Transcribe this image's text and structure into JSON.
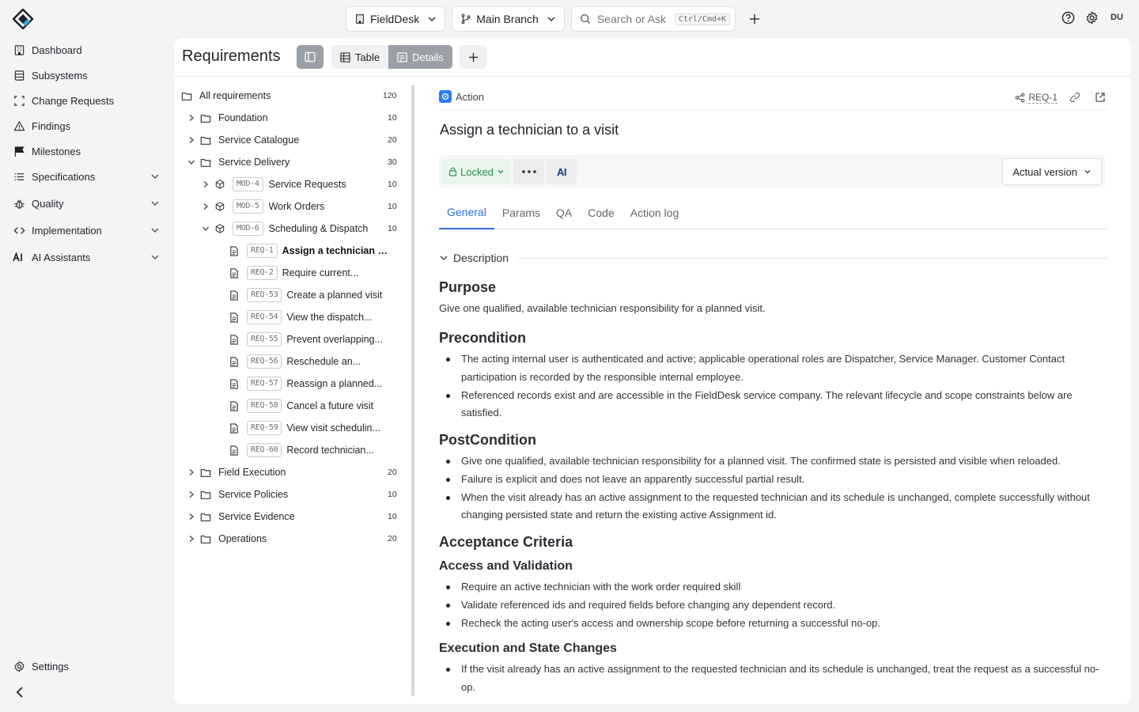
{
  "topbar": {
    "project": "FieldDesk",
    "branch": "Main Branch",
    "search_placeholder": "Search or Ask",
    "search_shortcut": "Ctrl/Cmd+K",
    "avatar": "DU"
  },
  "sidebar": {
    "items": [
      {
        "label": "Dashboard",
        "icon": "building-icon"
      },
      {
        "label": "Subsystems",
        "icon": "database-icon"
      },
      {
        "label": "Change Requests",
        "icon": "frame-icon"
      },
      {
        "label": "Findings",
        "icon": "warning-icon"
      },
      {
        "label": "Milestones",
        "icon": "flag-icon"
      },
      {
        "label": "Specifications",
        "icon": "list-icon"
      },
      {
        "label": "Quality",
        "icon": "bug-icon"
      },
      {
        "label": "Implementation",
        "icon": "code-icon"
      },
      {
        "label": "AI Assistants",
        "icon": "ai-icon"
      }
    ],
    "settings": "Settings"
  },
  "main": {
    "title": "Requirements",
    "views": [
      "Table",
      "Details"
    ],
    "active_view": "Details"
  },
  "tree": {
    "root": {
      "label": "All requirements",
      "count": "120"
    },
    "folders_top": [
      {
        "label": "Foundation",
        "count": "10"
      },
      {
        "label": "Service Catalogue",
        "count": "20"
      },
      {
        "label": "Service Delivery",
        "count": "30"
      }
    ],
    "modules": [
      {
        "tag": "MOD-4",
        "label": "Service Requests",
        "count": "10"
      },
      {
        "tag": "MOD-5",
        "label": "Work Orders",
        "count": "10"
      },
      {
        "tag": "MOD-6",
        "label": "Scheduling & Dispatch",
        "count": "10"
      }
    ],
    "requirements": [
      {
        "tag": "REQ-1",
        "label": "Assign a technician t..."
      },
      {
        "tag": "REQ-2",
        "label": "Require current..."
      },
      {
        "tag": "REQ-53",
        "label": "Create a planned visit"
      },
      {
        "tag": "REQ-54",
        "label": "View the dispatch..."
      },
      {
        "tag": "REQ-55",
        "label": "Prevent overlapping..."
      },
      {
        "tag": "REQ-56",
        "label": "Reschedule an..."
      },
      {
        "tag": "REQ-57",
        "label": "Reassign a planned..."
      },
      {
        "tag": "REQ-58",
        "label": "Cancel a future visit"
      },
      {
        "tag": "REQ-59",
        "label": "View visit schedulin..."
      },
      {
        "tag": "REQ-60",
        "label": "Record technician..."
      }
    ],
    "folders_bottom": [
      {
        "label": "Field Execution",
        "count": "20"
      },
      {
        "label": "Service Policies",
        "count": "10"
      },
      {
        "label": "Service Evidence",
        "count": "10"
      },
      {
        "label": "Operations",
        "count": "20"
      }
    ]
  },
  "detail": {
    "type": "Action",
    "req_id": "REQ-1",
    "title": "Assign a technician to a visit",
    "status": "Locked",
    "ai_label": "AI",
    "version": "Actual version",
    "tabs": [
      "General",
      "Params",
      "QA",
      "Code",
      "Action log"
    ],
    "active_tab": "General",
    "section": "Description",
    "purpose_heading": "Purpose",
    "purpose_text": "Give one qualified, available technician responsibility for a planned visit.",
    "precondition_heading": "Precondition",
    "precondition_items": [
      "The acting internal user is authenticated and active; applicable operational roles are Dispatcher, Service Manager. Customer Contact participation is recorded by the responsible internal employee.",
      "Referenced records exist and are accessible in the FieldDesk service company. The relevant lifecycle and scope constraints below are satisfied."
    ],
    "postcondition_heading": "PostCondition",
    "postcondition_items": [
      "Give one qualified, available technician responsibility for a planned visit. The confirmed state is persisted and visible when reloaded.",
      "Failure is explicit and does not leave an apparently successful partial result.",
      "When the visit already has an active assignment to the requested technician and its schedule is unchanged, complete successfully without changing persisted state and return the existing active Assignment id."
    ],
    "acceptance_heading": "Acceptance Criteria",
    "access_heading": "Access and Validation",
    "access_items": [
      "Require an active technician with the work order required skill",
      "Validate referenced ids and required fields before changing any dependent record.",
      "Recheck the acting user's access and ownership scope before returning a successful no-op."
    ],
    "execution_heading": "Execution and State Changes",
    "execution_items": [
      "If the visit already has an active assignment to the requested technician and its schedule is unchanged, treat the request as a successful no-op."
    ]
  },
  "colors": {
    "accent": "#2d6fd6",
    "locked_text": "#2e8a4a",
    "locked_bg": "#e8f6ec",
    "type_icon": "#2d7cf6"
  }
}
